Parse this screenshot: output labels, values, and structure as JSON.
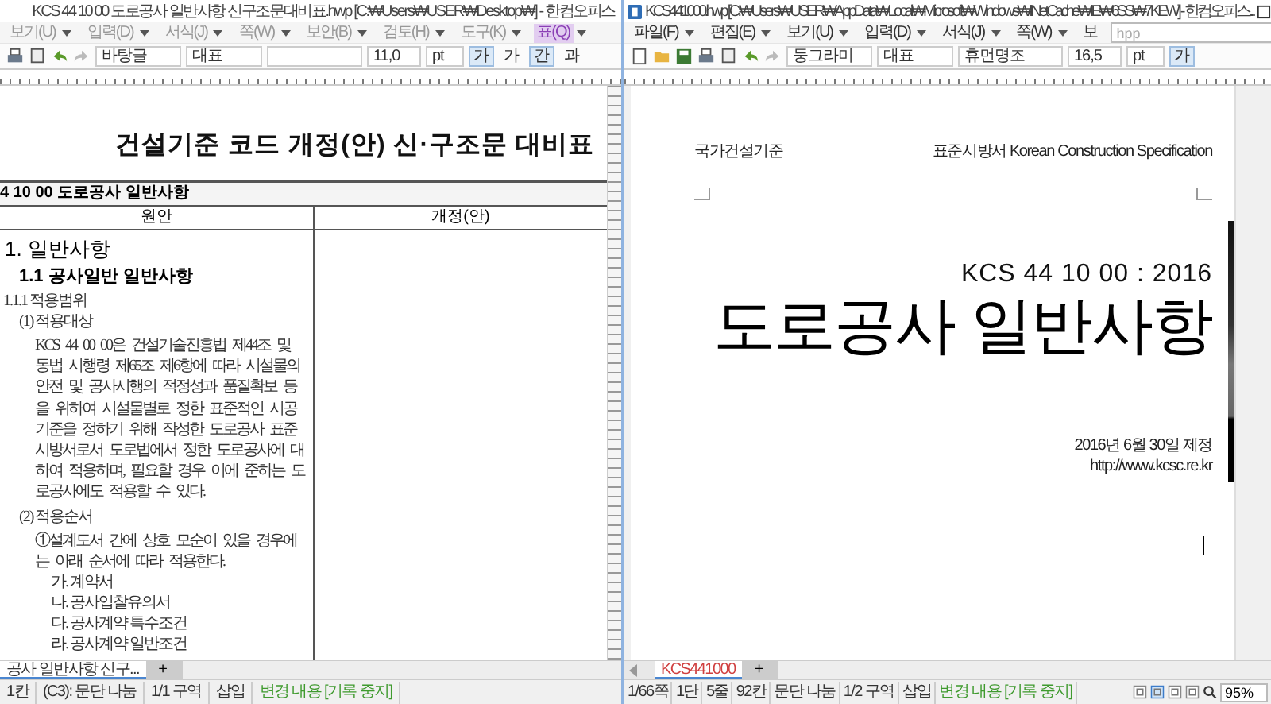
{
  "left_window": {
    "title": "KCS 44 10 00 도로공사 일반사항 신구조문대비표.hwp [C:₩Users₩USER₩Desktop₩] - 한컴오피스",
    "menu": [
      {
        "label": "보기(U)",
        "selected": false
      },
      {
        "label": "입력(D)",
        "selected": false
      },
      {
        "label": "서식(J)",
        "selected": false
      },
      {
        "label": "쪽(W)",
        "selected": false
      },
      {
        "label": "보안(B)",
        "selected": false
      },
      {
        "label": "검토(H)",
        "selected": false
      },
      {
        "label": "도구(K)",
        "selected": false
      },
      {
        "label": "표(Q)",
        "selected": true
      }
    ],
    "toolbar": {
      "style": "바탕글",
      "language": "대표",
      "size": "11,0",
      "unit": "pt",
      "format_buttons": [
        {
          "label": "가",
          "selected": true
        },
        {
          "label": "가",
          "selected": false
        },
        {
          "label": "간",
          "selected": true
        },
        {
          "label": "과",
          "selected": false
        }
      ]
    },
    "document": {
      "heading": "건설기준 코드 개정(안) 신·구조문 대비표",
      "table_title": "4 10 00 도로공사 일반사항",
      "columns": [
        "원안",
        "개정(안)"
      ],
      "content": [
        {
          "kind": "h1",
          "text": "1. 일반사항"
        },
        {
          "kind": "h2",
          "text": "1.1 공사일반 일반사항"
        },
        {
          "kind": "h3",
          "text": "1.1.1 적용범위"
        },
        {
          "kind": "item",
          "text": "(1) 적용대상"
        },
        {
          "kind": "para",
          "text": "KCS 44 00 00은 건설기술진흥법 제44조 및 동법 시행령 제65조 제6항에 따라 시설물의 안전 및 공사시행의 적정성과 품질확보 등을 위하여 시설물별로 정한 표준적인 시공기준을 정하기 위해 작성한 도로공사 표준시방서로서 도로법에서 정한 도로공사에 대하여 적용하며, 필요할 경우 이에 준하는 도로공사에도 적용할 수 있다."
        },
        {
          "kind": "item",
          "text": "(2) 적용순서"
        },
        {
          "kind": "circled",
          "text": "①설계도서 간에 상호 모순이 있을 경우에는 아래 순서에 따라 적용한다."
        },
        {
          "kind": "sub",
          "text": "가. 계약서"
        },
        {
          "kind": "sub",
          "text": "나. 공사입찰유의서"
        },
        {
          "kind": "sub",
          "text": "다. 공사계약 특수조건"
        },
        {
          "kind": "sub",
          "text": "라. 공사계약 일반조건"
        }
      ]
    },
    "doc_tab": {
      "label": "공사 일반사항 신구...",
      "selected": true
    },
    "add_tab": "+",
    "status_bar": [
      {
        "text": "1칸",
        "kind": "plain"
      },
      {
        "text": "(C3): 문단 나눔",
        "kind": "plain"
      },
      {
        "text": "1/1 구역",
        "kind": "plain"
      },
      {
        "text": "삽입",
        "kind": "plain"
      },
      {
        "text": "변경 내용 [기록 중지]",
        "kind": "track"
      }
    ]
  },
  "right_window": {
    "title": "KCS441000.hwp [C:₩Users₩USER₩AppData₩Local₩Microsoft₩Windows₩INetCache₩IE₩6SS₩7KEW] - 한컴오피스...",
    "menu": [
      {
        "label": "파일(F)",
        "selected": false
      },
      {
        "label": "편집(E)",
        "selected": false
      },
      {
        "label": "보기(U)",
        "selected": false
      },
      {
        "label": "입력(D)",
        "selected": false
      },
      {
        "label": "서식(J)",
        "selected": false
      },
      {
        "label": "쪽(W)",
        "selected": false
      },
      {
        "label": "보",
        "selected": false
      }
    ],
    "search": {
      "placeholder": "hpp"
    },
    "toolbar": {
      "style": "둥그라미",
      "language": "대표",
      "font": "휴먼명조",
      "size": "16,5",
      "unit": "pt",
      "format_buttons": [
        {
          "label": "가",
          "selected": true
        }
      ]
    },
    "document": {
      "header_left": "국가건설기준",
      "header_right": "표준시방서 Korean Construction Specification",
      "code": "KCS 44 10 00 : 2016",
      "title": "도로공사 일반사항",
      "date": "2016년 6월 30일 제정",
      "url": "http://www.kcsc.re.kr"
    },
    "doc_tab": {
      "label": "KCS441000",
      "selected": true
    },
    "add_tab": "+",
    "status_bar": [
      {
        "text": "1/66쪽",
        "kind": "plain"
      },
      {
        "text": "1단",
        "kind": "plain"
      },
      {
        "text": "5줄",
        "kind": "plain"
      },
      {
        "text": "92칸",
        "kind": "plain"
      },
      {
        "text": "문단 나눔",
        "kind": "plain"
      },
      {
        "text": "1/2 구역",
        "kind": "plain"
      },
      {
        "text": "삽입",
        "kind": "plain"
      },
      {
        "text": "변경 내용 [기록 중지]",
        "kind": "track"
      }
    ],
    "views": [
      {
        "selected": false
      },
      {
        "selected": true
      },
      {
        "selected": false
      },
      {
        "selected": false
      }
    ],
    "zoom": "95%"
  }
}
